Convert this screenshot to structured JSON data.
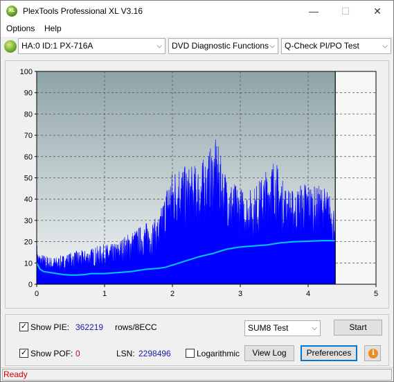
{
  "window": {
    "title": "PlexTools Professional XL V3.16",
    "app_icon_text": "XL",
    "minimize_icon": "—",
    "maximize_icon": "☐",
    "close_icon": "✕"
  },
  "menu": {
    "options": "Options",
    "help": "Help"
  },
  "toolbar": {
    "drive": "HA:0 ID:1  PX-716A",
    "function": "DVD Diagnostic Functions",
    "test": "Q-Check PI/PO Test",
    "dropdown_arrow": "⌵"
  },
  "chart_data": {
    "type": "area",
    "x_ticks": [
      "0",
      "1",
      "2",
      "3",
      "4",
      "5"
    ],
    "y_ticks": [
      "0",
      "10",
      "20",
      "30",
      "40",
      "50",
      "60",
      "70",
      "80",
      "90",
      "100"
    ],
    "xlim": [
      0,
      5
    ],
    "ylim": [
      0,
      100
    ],
    "end_marker_x": 4.4,
    "grid": true,
    "series": [
      {
        "kind": "pie-area",
        "color": "#0000ff",
        "x": [
          0,
          0.02,
          0.1,
          0.2,
          0.3,
          0.4,
          0.5,
          0.6,
          0.7,
          0.8,
          0.9,
          1.0,
          1.1,
          1.2,
          1.3,
          1.4,
          1.5,
          1.6,
          1.7,
          1.8,
          1.85,
          1.9,
          1.95,
          2.0,
          2.05,
          2.1,
          2.2,
          2.3,
          2.4,
          2.5,
          2.55,
          2.6,
          2.65,
          2.7,
          2.75,
          2.8,
          2.9,
          3.0,
          3.1,
          3.2,
          3.3,
          3.4,
          3.45,
          3.5,
          3.55,
          3.6,
          3.7,
          3.8,
          3.9,
          4.0,
          4.1,
          4.2,
          4.3,
          4.35,
          4.4
        ],
        "avg": [
          18,
          14,
          11,
          10,
          10,
          11,
          12,
          13,
          13,
          14,
          14,
          15,
          15,
          16,
          18,
          20,
          22,
          23,
          24,
          27,
          32,
          36,
          40,
          44,
          45,
          48,
          47,
          44,
          45,
          52,
          55,
          58,
          60,
          55,
          50,
          45,
          40,
          38,
          37,
          38,
          42,
          48,
          52,
          56,
          50,
          44,
          40,
          38,
          42,
          42,
          40,
          40,
          38,
          34,
          30
        ],
        "peak": [
          20,
          15,
          14,
          13,
          13,
          14,
          15,
          16,
          16,
          17,
          18,
          19,
          19,
          20,
          23,
          25,
          27,
          29,
          30,
          32,
          38,
          45,
          52,
          54,
          56,
          58,
          55,
          56,
          57,
          61,
          64,
          66,
          69,
          62,
          56,
          52,
          48,
          46,
          44,
          46,
          50,
          55,
          57,
          60,
          56,
          50,
          46,
          44,
          48,
          49,
          46,
          47,
          44,
          40,
          36
        ]
      },
      {
        "kind": "avg-line",
        "color": "#00c8ff",
        "x": [
          0,
          0.05,
          0.1,
          0.2,
          0.3,
          0.4,
          0.5,
          0.6,
          0.7,
          0.8,
          1.0,
          1.2,
          1.4,
          1.6,
          1.8,
          1.9,
          2.0,
          2.2,
          2.4,
          2.6,
          2.8,
          3.0,
          3.2,
          3.4,
          3.5,
          3.6,
          3.8,
          4.0,
          4.2,
          4.4
        ],
        "y": [
          10,
          7,
          6,
          5.5,
          5,
          4.5,
          4.3,
          4.3,
          4.5,
          5,
          5,
          5.5,
          6,
          7,
          7.5,
          8,
          9,
          11,
          13,
          14.5,
          16.5,
          17.5,
          18,
          18.5,
          19,
          19.5,
          20,
          20.2,
          20.5,
          20.5
        ]
      }
    ]
  },
  "controls": {
    "show_pie_label": "Show PIE:",
    "pie_value": "362219",
    "pie_unit": "rows/8ECC",
    "show_pof_label": "Show POF:",
    "pof_value": "0",
    "lsn_label": "LSN:",
    "lsn_value": "2298496",
    "logarithmic_label": "Logarithmic",
    "sum_select": "SUM8 Test",
    "start_button": "Start",
    "view_log_button": "View Log",
    "preferences_button": "Preferences",
    "info_icon": "i",
    "check_mark": "✓"
  },
  "status": {
    "text": "Ready"
  }
}
